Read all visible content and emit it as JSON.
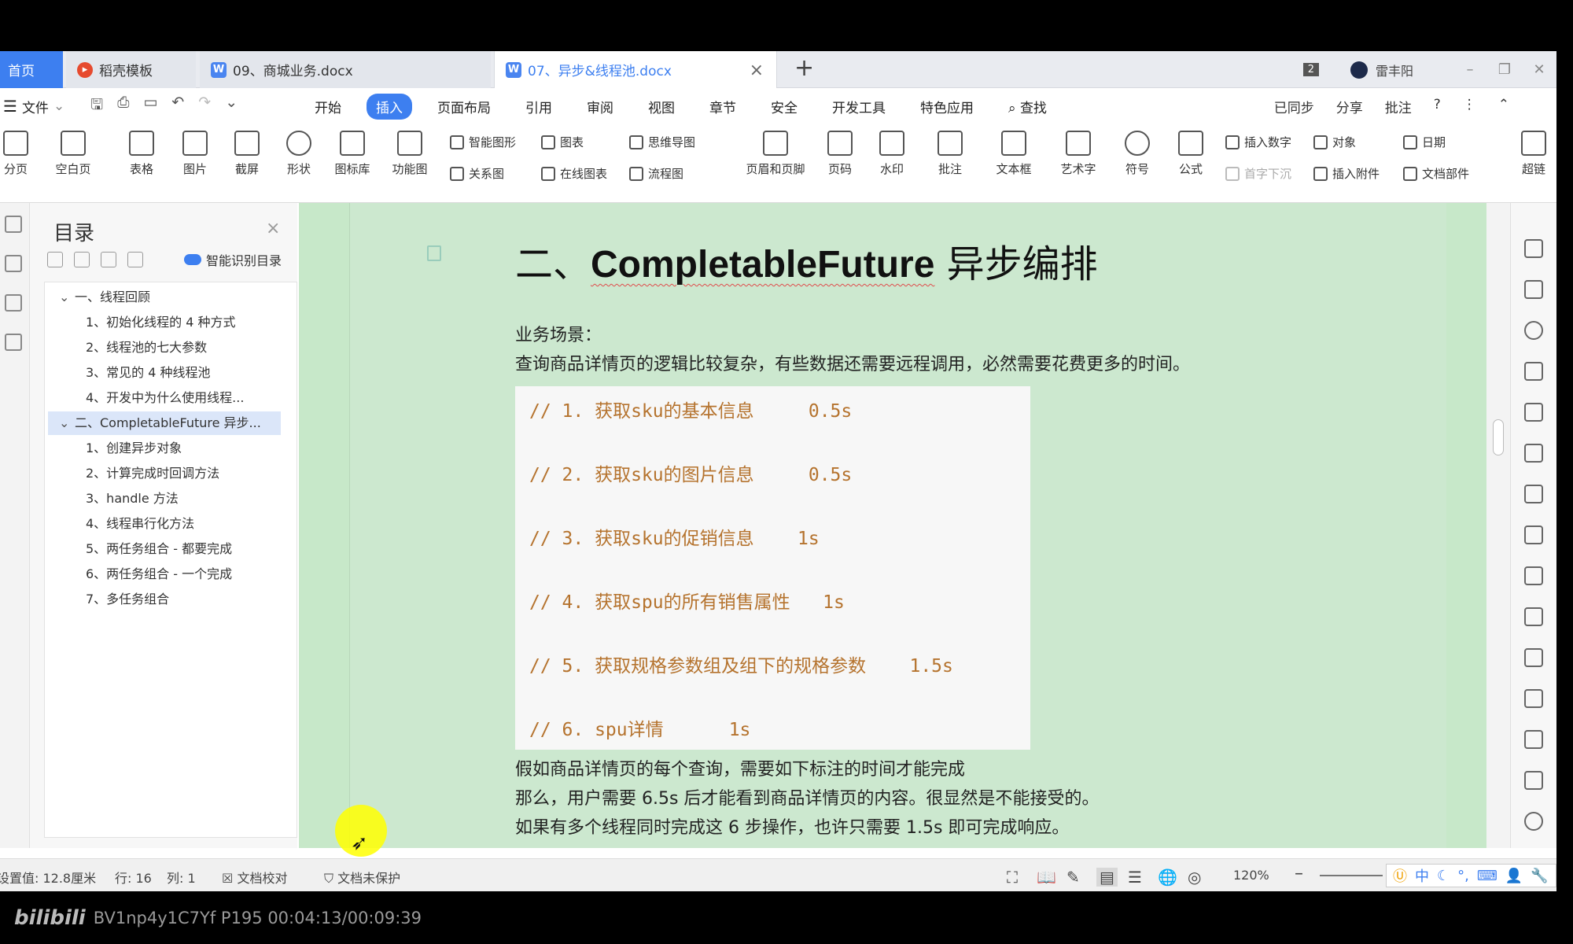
{
  "tabs": [
    {
      "label": "首页"
    },
    {
      "label": "稻壳模板",
      "icon": "wps-docer-icon"
    },
    {
      "label": "09、商城业务.docx",
      "icon": "word-doc-icon"
    },
    {
      "label": "07、异步&线程池.docx",
      "icon": "word-doc-icon"
    }
  ],
  "window": {
    "badge": "2",
    "user": "雷丰阳"
  },
  "menu": {
    "file": "文件",
    "tabs": [
      "开始",
      "插入",
      "页面布局",
      "引用",
      "审阅",
      "视图",
      "章节",
      "安全",
      "开发工具",
      "特色应用",
      "查找"
    ],
    "active_tab": "插入",
    "right": [
      "已同步",
      "分享",
      "批注"
    ]
  },
  "ribbon": {
    "big": [
      "分页",
      "空白页",
      "表格",
      "图片",
      "截屏",
      "形状",
      "图标库",
      "功能图",
      "页眉和页脚",
      "页码",
      "水印",
      "批注",
      "文本框",
      "艺术字",
      "符号",
      "公式",
      "超链"
    ],
    "small": [
      "智能图形",
      "图表",
      "思维导图",
      "关系图",
      "在线图表",
      "流程图",
      "插入数字",
      "对象",
      "日期",
      "首字下沉",
      "插入附件",
      "文档部件"
    ]
  },
  "toc": {
    "title": "目录",
    "smart_label": "智能识别目录",
    "items": [
      {
        "label": "一、线程回顾"
      },
      {
        "label": "1、初始化线程的 4 种方式"
      },
      {
        "label": "2、线程池的七大参数"
      },
      {
        "label": "3、常见的 4 种线程池"
      },
      {
        "label": "4、开发中为什么使用线程..."
      },
      {
        "label": "二、CompletableFuture 异步..."
      },
      {
        "label": "1、创建异步对象"
      },
      {
        "label": "2、计算完成时回调方法"
      },
      {
        "label": "3、handle 方法"
      },
      {
        "label": "4、线程串行化方法"
      },
      {
        "label": "5、两任务组合 - 都要完成"
      },
      {
        "label": "6、两任务组合 - 一个完成"
      },
      {
        "label": "7、多任务组合"
      }
    ]
  },
  "doc": {
    "heading_prefix": "二、",
    "heading_en": "CompletableFuture",
    "heading_suffix": " 异步编排",
    "scene_label": "业务场景：",
    "scene_text": "查询商品详情页的逻辑比较复杂，有些数据还需要远程调用，必然需要花费更多的时间。",
    "code": [
      "// 1. 获取sku的基本信息     0.5s",
      "// 2. 获取sku的图片信息     0.5s",
      "// 3. 获取sku的促销信息    1s",
      "// 4. 获取spu的所有销售属性   1s",
      "// 5. 获取规格参数组及组下的规格参数    1.5s",
      "// 6. spu详情      1s"
    ],
    "after": [
      "假如商品详情页的每个查询，需要如下标注的时间才能完成",
      "那么，用户需要 6.5s 后才能看到商品详情页的内容。很显然是不能接受的。",
      "如果有多个线程同时完成这 6 步操作，也许只需要 1.5s 即可完成响应。"
    ]
  },
  "status": {
    "setting": "设置值: 12.8厘米",
    "row": "行: 16",
    "col": "列: 1",
    "proof": "文档校对",
    "protect": "文档未保护",
    "zoom": "120%",
    "ime": "中"
  },
  "video": {
    "logo": "bilibili",
    "info": "BV1np4y1C7Yf P195 00:04:13/00:09:39"
  }
}
